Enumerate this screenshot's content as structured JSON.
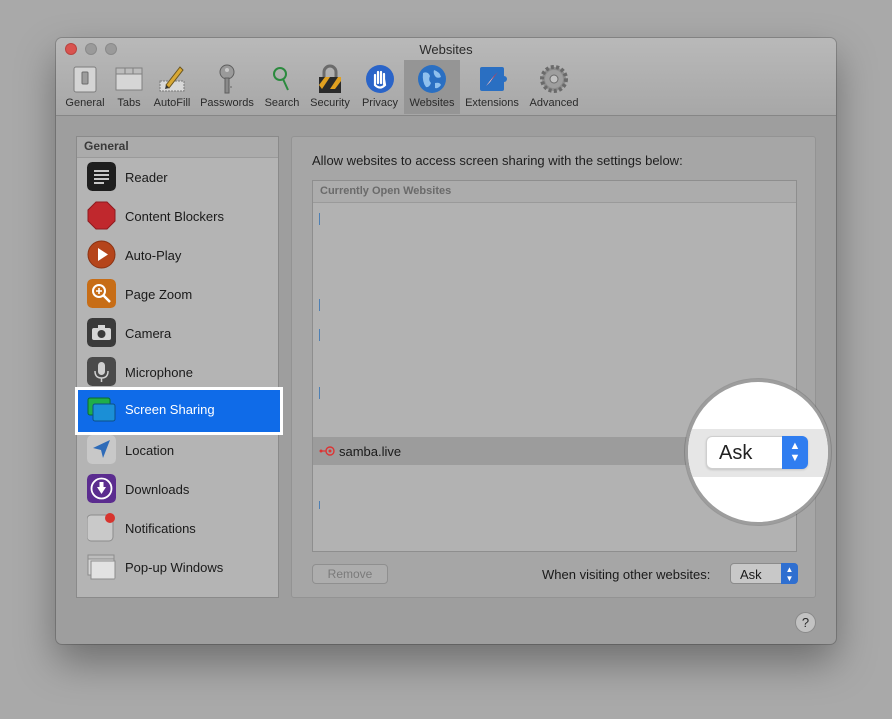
{
  "window": {
    "title": "Websites"
  },
  "toolbar": {
    "items": [
      {
        "label": "General",
        "icon": "general-switch-icon"
      },
      {
        "label": "Tabs",
        "icon": "tabs-icon"
      },
      {
        "label": "AutoFill",
        "icon": "autofill-pencil-icon"
      },
      {
        "label": "Passwords",
        "icon": "key-icon"
      },
      {
        "label": "Search",
        "icon": "magnifier-icon"
      },
      {
        "label": "Security",
        "icon": "lock-icon"
      },
      {
        "label": "Privacy",
        "icon": "hand-icon"
      },
      {
        "label": "Websites",
        "icon": "globe-icon",
        "selected": true
      },
      {
        "label": "Extensions",
        "icon": "puzzle-compass-icon"
      },
      {
        "label": "Advanced",
        "icon": "gear-icon"
      }
    ]
  },
  "sidebar": {
    "header": "General",
    "items": [
      {
        "label": "Reader",
        "color": "#1e1e1e"
      },
      {
        "label": "Content Blockers",
        "color": "#c0282d"
      },
      {
        "label": "Auto-Play",
        "color": "#b5451b"
      },
      {
        "label": "Page Zoom",
        "color": "#c76d16"
      },
      {
        "label": "Camera",
        "color": "#3a3a3a"
      },
      {
        "label": "Microphone",
        "color": "#4a4a4a"
      },
      {
        "label": "Screen Sharing",
        "color": "#1fae4a",
        "selected": true
      },
      {
        "label": "Location",
        "color": "#2e6bb8"
      },
      {
        "label": "Downloads",
        "color": "#5b2c8f"
      },
      {
        "label": "Notifications",
        "color": "#c9c9c9"
      },
      {
        "label": "Pop-up Windows",
        "color": "#cfcfcf"
      }
    ]
  },
  "main": {
    "intro": "Allow websites to access screen sharing with the settings below:",
    "table_header": "Currently Open Websites",
    "row": {
      "site": "samba.live",
      "value": "Ask"
    },
    "remove_button": "Remove",
    "other_label": "When visiting other websites:",
    "other_value": "Ask"
  },
  "help": "?",
  "magnifier": {
    "value": "Ask"
  },
  "colors": {
    "accent": "#0f6be8",
    "select_arrow": "#2f6fd0"
  }
}
